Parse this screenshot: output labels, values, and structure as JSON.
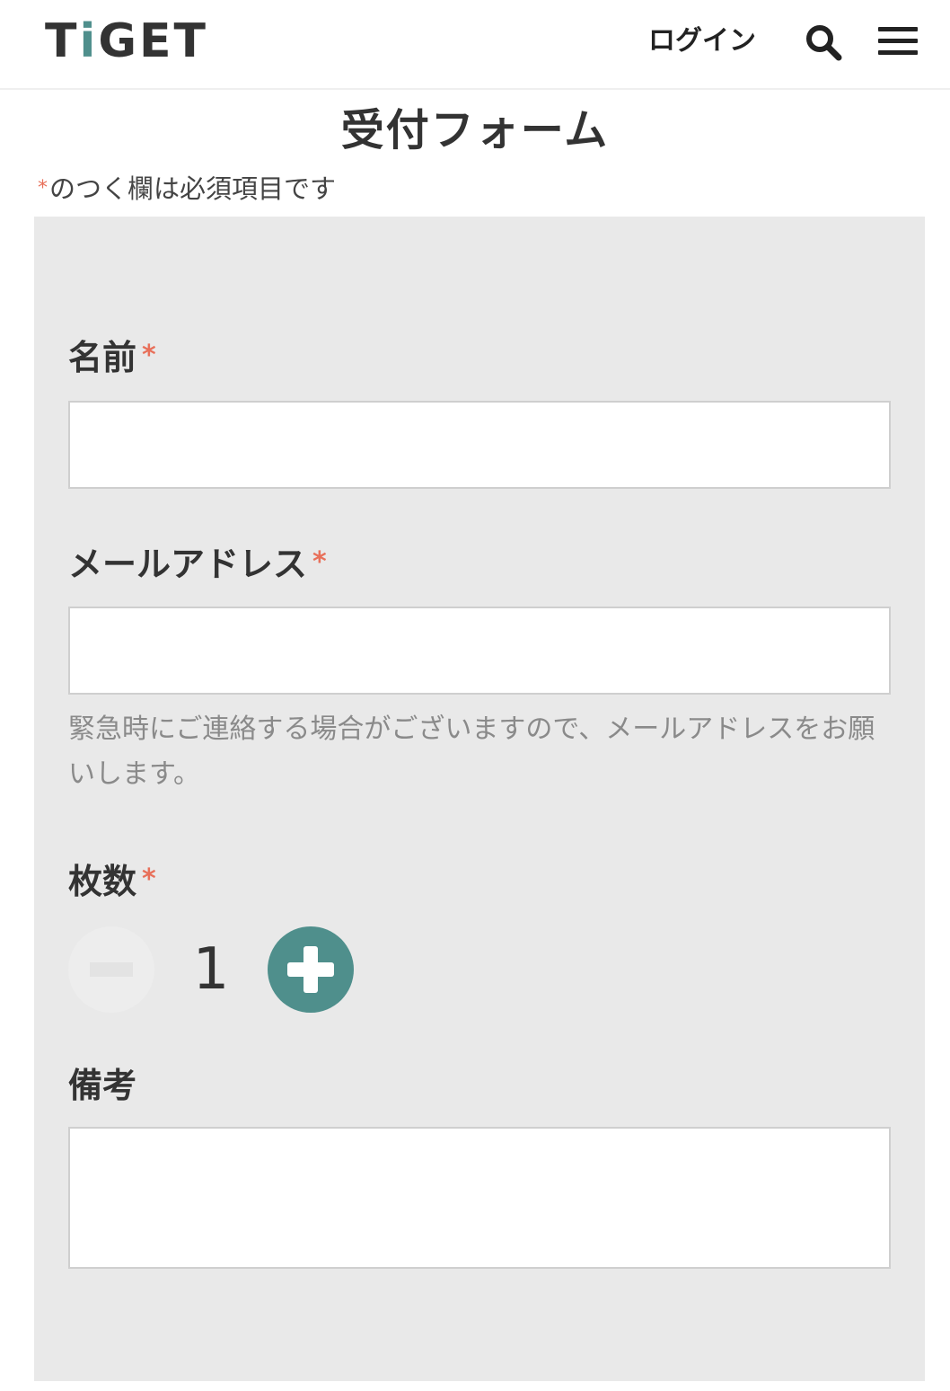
{
  "header": {
    "logo_prefix": "T",
    "logo_i": "i",
    "logo_suffix": "GET",
    "login_label": "ログイン",
    "search_icon": "search-icon",
    "menu_icon": "hamburger-menu-icon",
    "accent_color": "#4f8f8c"
  },
  "page": {
    "title": "受付フォーム",
    "required_mark": "*",
    "required_note": "のつく欄は必須項目です"
  },
  "form": {
    "name": {
      "label": "名前",
      "required_mark": "*",
      "value": ""
    },
    "email": {
      "label": "メールアドレス",
      "required_mark": "*",
      "value": "",
      "help_text": "緊急時にご連絡する場合がございますので、メールアドレスをお願いします。"
    },
    "quantity": {
      "label": "枚数",
      "required_mark": "*",
      "value": "1",
      "minus_icon": "minus-icon",
      "plus_icon": "plus-icon"
    },
    "notes": {
      "label": "備考",
      "value": ""
    }
  },
  "colors": {
    "required": "#e8705a",
    "panel_background": "#e9e9e9",
    "stepper_active": "#4f8f8c"
  }
}
